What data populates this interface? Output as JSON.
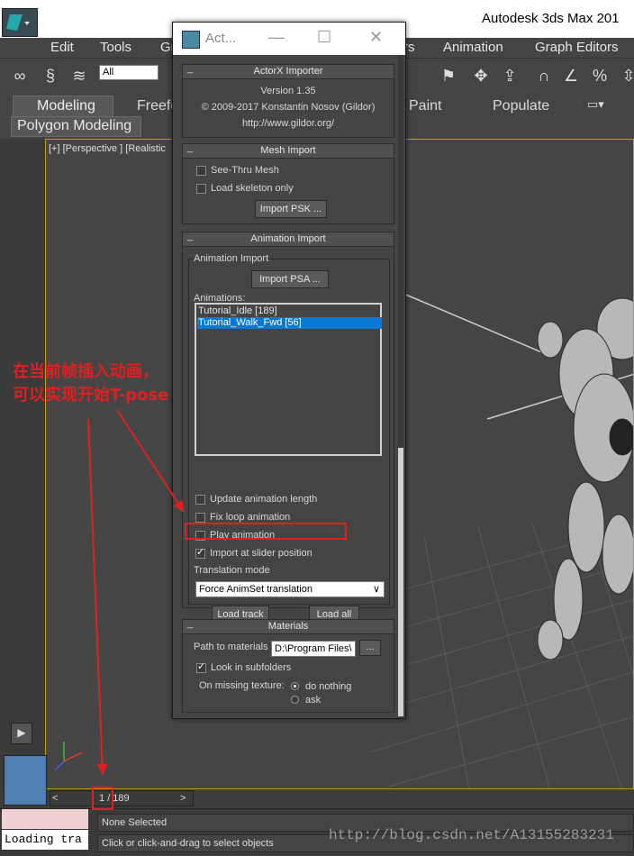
{
  "app": {
    "title": "Autodesk 3ds Max  201"
  },
  "menu": [
    "Edit",
    "Tools",
    "Gr",
    "rs",
    "Animation",
    "Graph Editors"
  ],
  "toolbar": {
    "selection_filter": "All"
  },
  "ribbon": {
    "tabs": [
      "Modeling",
      "Freefo",
      "Paint",
      "Populate"
    ],
    "subtab": "Polygon Modeling"
  },
  "viewport": {
    "label": "[+] [Perspective ] [Realistic"
  },
  "dialog": {
    "title": "Act...",
    "importer": {
      "header": "ActorX Importer",
      "version": "Version 1.35",
      "copyright": "© 2009-2017 Konstantin Nosov (Gildor)",
      "url": "http://www.gildor.org/"
    },
    "mesh_import": {
      "header": "Mesh Import",
      "see_thru": "See-Thru Mesh",
      "skeleton_only": "Load skeleton only",
      "import_psk": "Import PSK ..."
    },
    "animation_import": {
      "header": "Animation Import",
      "group_label": "Animation Import",
      "import_psa": "Import PSA ...",
      "animations_label": "Animations:",
      "animations": [
        "Tutorial_Idle [189]",
        "Tutorial_Walk_Fwd [56]"
      ],
      "selected_index": 1,
      "update_length": "Update animation length",
      "fix_loop": "Fix loop animation",
      "play_anim": "Play animation",
      "import_slider": "Import at slider position",
      "translation_label": "Translation mode",
      "translation_value": "Force AnimSet translation",
      "load_track": "Load track",
      "load_all": "Load all"
    },
    "materials": {
      "header": "Materials",
      "path_label": "Path to materials",
      "path_value": "D:\\Program Files\\",
      "browse": "...",
      "look_sub": "Look in subfolders",
      "missing_label": "On missing texture:",
      "opt_nothing": "do nothing",
      "opt_ask": "ask"
    }
  },
  "timeline": {
    "frame": "1",
    "total": "/ 189",
    "prev": "<",
    "next": ">"
  },
  "status": {
    "script": "Loading tra",
    "line1": "None Selected",
    "line2": "Click or click-and-drag to select objects"
  },
  "watermark": "http://blog.csdn.net/A13155283231",
  "annotation": {
    "line1": "在当前帧插入动画，",
    "line2": "可以实现开始T-pose"
  },
  "colors": {
    "accent": "#e02020",
    "selection": "#0a78d7",
    "viewport_border": "#c89a00"
  }
}
